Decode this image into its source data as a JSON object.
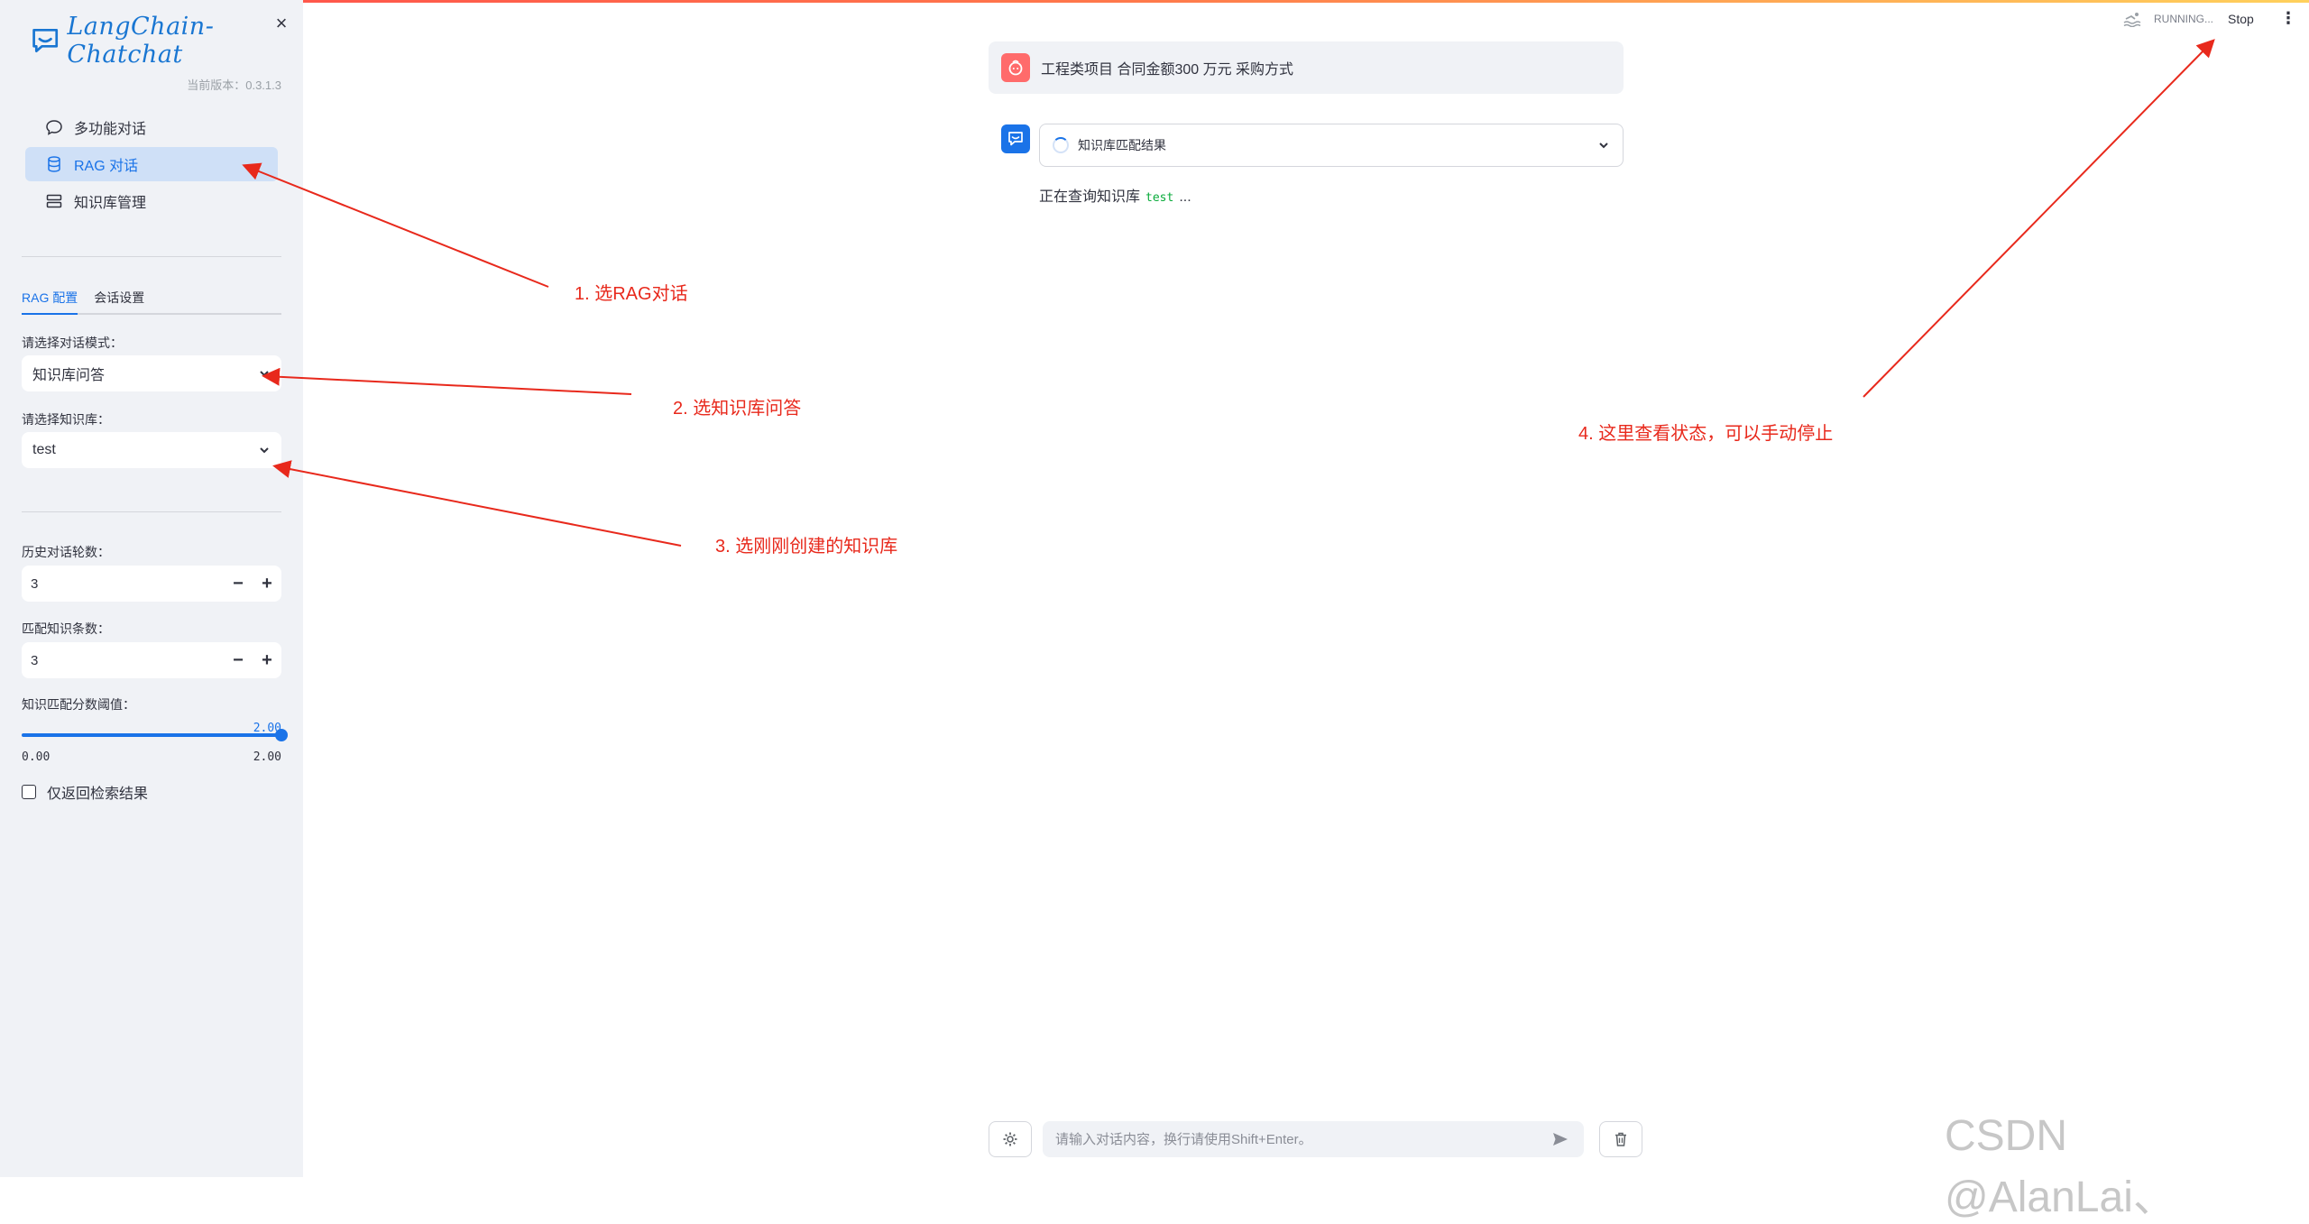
{
  "app": {
    "name": "LangChain-Chatchat",
    "version_label": "当前版本：0.3.1.3",
    "close_glyph": "×"
  },
  "sidebar": {
    "nav": [
      {
        "label": "多功能对话",
        "icon": "chat-bubble-icon",
        "active": false
      },
      {
        "label": "RAG 对话",
        "icon": "database-icon",
        "active": true
      },
      {
        "label": "知识库管理",
        "icon": "server-stack-icon",
        "active": false
      }
    ],
    "tabs": [
      {
        "label": "RAG 配置",
        "active": true
      },
      {
        "label": "会话设置",
        "active": false
      }
    ],
    "mode_label": "请选择对话模式：",
    "mode_value": "知识库问答",
    "kb_label": "请选择知识库：",
    "kb_value": "test",
    "history_label": "历史对话轮数：",
    "history_value": "3",
    "match_label": "匹配知识条数：",
    "match_value": "3",
    "threshold_label": "知识匹配分数阈值：",
    "threshold_value": "2.00",
    "threshold_fraction": 1.0,
    "threshold_min": "0.00",
    "threshold_max": "2.00",
    "checkbox_label": "仅返回检索结果",
    "checkbox_checked": false
  },
  "header": {
    "status": "RUNNING...",
    "stop_label": "Stop",
    "menu_glyph": "⋮"
  },
  "chat": {
    "user_message": "工程类项目 合同金额300 万元 采购方式",
    "expander_title": "知识库匹配结果",
    "bot_text_prefix": "正在查询知识库",
    "bot_code": "test",
    "bot_text_suffix": "..."
  },
  "input": {
    "placeholder": "请输入对话内容，换行请使用Shift+Enter。"
  },
  "annotations": [
    "1. 选RAG对话",
    "2. 选知识库问答",
    "3. 选刚刚创建的知识库",
    "4. 这里查看状态，可以手动停止"
  ],
  "watermark": "CSDN @AlanLai、",
  "colors": {
    "accent": "#1a73e8",
    "annotation": "#e8291c",
    "sidebar_bg": "#f0f2f6",
    "user_avatar": "#ff6b6b"
  }
}
